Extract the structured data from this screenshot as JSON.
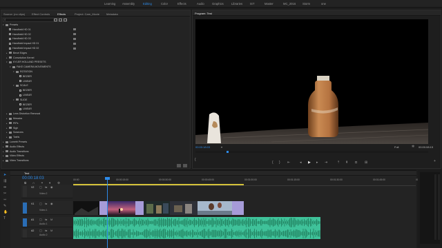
{
  "workspaces": [
    {
      "label": "Learning",
      "active": false
    },
    {
      "label": "Assembly",
      "active": false
    },
    {
      "label": "Editing",
      "active": true
    },
    {
      "label": "Color",
      "active": false
    },
    {
      "label": "Effects",
      "active": false
    },
    {
      "label": "Audio",
      "active": false
    },
    {
      "label": "Graphics",
      "active": false
    },
    {
      "label": "Libraries",
      "active": false
    },
    {
      "label": "IST",
      "active": false
    },
    {
      "label": "Master",
      "active": false
    },
    {
      "label": "MC_2016",
      "active": false
    },
    {
      "label": "Storm",
      "active": false
    },
    {
      "label": "one",
      "active": false
    }
  ],
  "left_panel": {
    "tabs": [
      {
        "label": "Source: (no clips)",
        "active": false
      },
      {
        "label": "Effect Controls",
        "active": false
      },
      {
        "label": "Effects",
        "active": true
      },
      {
        "label": "Project: Cam_Movie",
        "active": false
      },
      {
        "label": "Metadata",
        "active": false
      }
    ],
    "search_placeholder": "",
    "tree": [
      {
        "label": "Presets",
        "indent": 0,
        "type": "folder",
        "open": true
      },
      {
        "label": "Handheld HD 01",
        "indent": 1,
        "type": "preset"
      },
      {
        "label": "Handheld HD 02",
        "indent": 1,
        "type": "preset"
      },
      {
        "label": "Handheld HD 03",
        "indent": 1,
        "type": "preset"
      },
      {
        "label": "Handheld Impact HD 01",
        "indent": 1,
        "type": "preset"
      },
      {
        "label": "Handheld Impact HD 02",
        "indent": 1,
        "type": "preset"
      },
      {
        "label": "Bevel Edges",
        "indent": 1,
        "type": "folder",
        "open": false
      },
      {
        "label": "Convolution Kernel",
        "indent": 1,
        "type": "folder",
        "open": false
      },
      {
        "label": "KYLER HOLLAND PRESETS",
        "indent": 1,
        "type": "folder",
        "open": true
      },
      {
        "label": "FAKE CAMERA MOVEMENTS",
        "indent": 2,
        "type": "folder",
        "open": true
      },
      {
        "label": "ROTATION",
        "indent": 3,
        "type": "folder",
        "open": true
      },
      {
        "label": "BEZIER",
        "indent": 4,
        "type": "preset"
      },
      {
        "label": "LINEAR",
        "indent": 4,
        "type": "preset"
      },
      {
        "label": "SCALE",
        "indent": 3,
        "type": "folder",
        "open": true
      },
      {
        "label": "BEZIER",
        "indent": 4,
        "type": "preset"
      },
      {
        "label": "LINEAR",
        "indent": 4,
        "type": "preset"
      },
      {
        "label": "SLIDE",
        "indent": 3,
        "type": "folder",
        "open": true
      },
      {
        "label": "BEZIER",
        "indent": 4,
        "type": "preset"
      },
      {
        "label": "LINEAR",
        "indent": 4,
        "type": "preset"
      },
      {
        "label": "Lens Distortion Removal",
        "indent": 1,
        "type": "folder",
        "open": false
      },
      {
        "label": "Mosaics",
        "indent": 1,
        "type": "folder",
        "open": false
      },
      {
        "label": "PiPs",
        "indent": 1,
        "type": "folder",
        "open": false
      },
      {
        "label": "Sigh",
        "indent": 1,
        "type": "folder",
        "open": false
      },
      {
        "label": "Solarizes",
        "indent": 1,
        "type": "folder",
        "open": false
      },
      {
        "label": "Twirls",
        "indent": 1,
        "type": "folder",
        "open": false
      },
      {
        "label": "Lumetri Presets",
        "indent": 0,
        "type": "folder",
        "open": false
      },
      {
        "label": "Audio Effects",
        "indent": 0,
        "type": "folder",
        "open": false
      },
      {
        "label": "Audio Transitions",
        "indent": 0,
        "type": "folder",
        "open": false
      },
      {
        "label": "Video Effects",
        "indent": 0,
        "type": "folder",
        "open": false
      },
      {
        "label": "Video Transitions",
        "indent": 0,
        "type": "folder",
        "open": false
      }
    ]
  },
  "program": {
    "title": "Program: Test",
    "timecode": "00:00:18:03",
    "fit_label": "Full",
    "duration": "00:00:08:15"
  },
  "timeline": {
    "sequence_name": "Test",
    "timecode": "00:00:18:03",
    "ruler": [
      "00:00",
      "00:00:15:00",
      "00:00:30:00",
      "00:00:45:00",
      "00:01:00:00",
      "00:01:15:00",
      "00:01:30:00",
      "00:01:45:00",
      "00:02:00:00"
    ],
    "tracks": [
      {
        "id": "V2",
        "name": "Video 2"
      },
      {
        "id": "V1",
        "name": "Video 1"
      },
      {
        "id": "A1",
        "name": "Audio 1"
      },
      {
        "id": "A2",
        "name": "Audio 2"
      }
    ],
    "playhead_fraction": 0.138
  },
  "colors": {
    "accent": "#2d8ceb",
    "video_clip": "#a69bd8",
    "audio_clip": "#3fc29a",
    "panel": "#232323"
  }
}
